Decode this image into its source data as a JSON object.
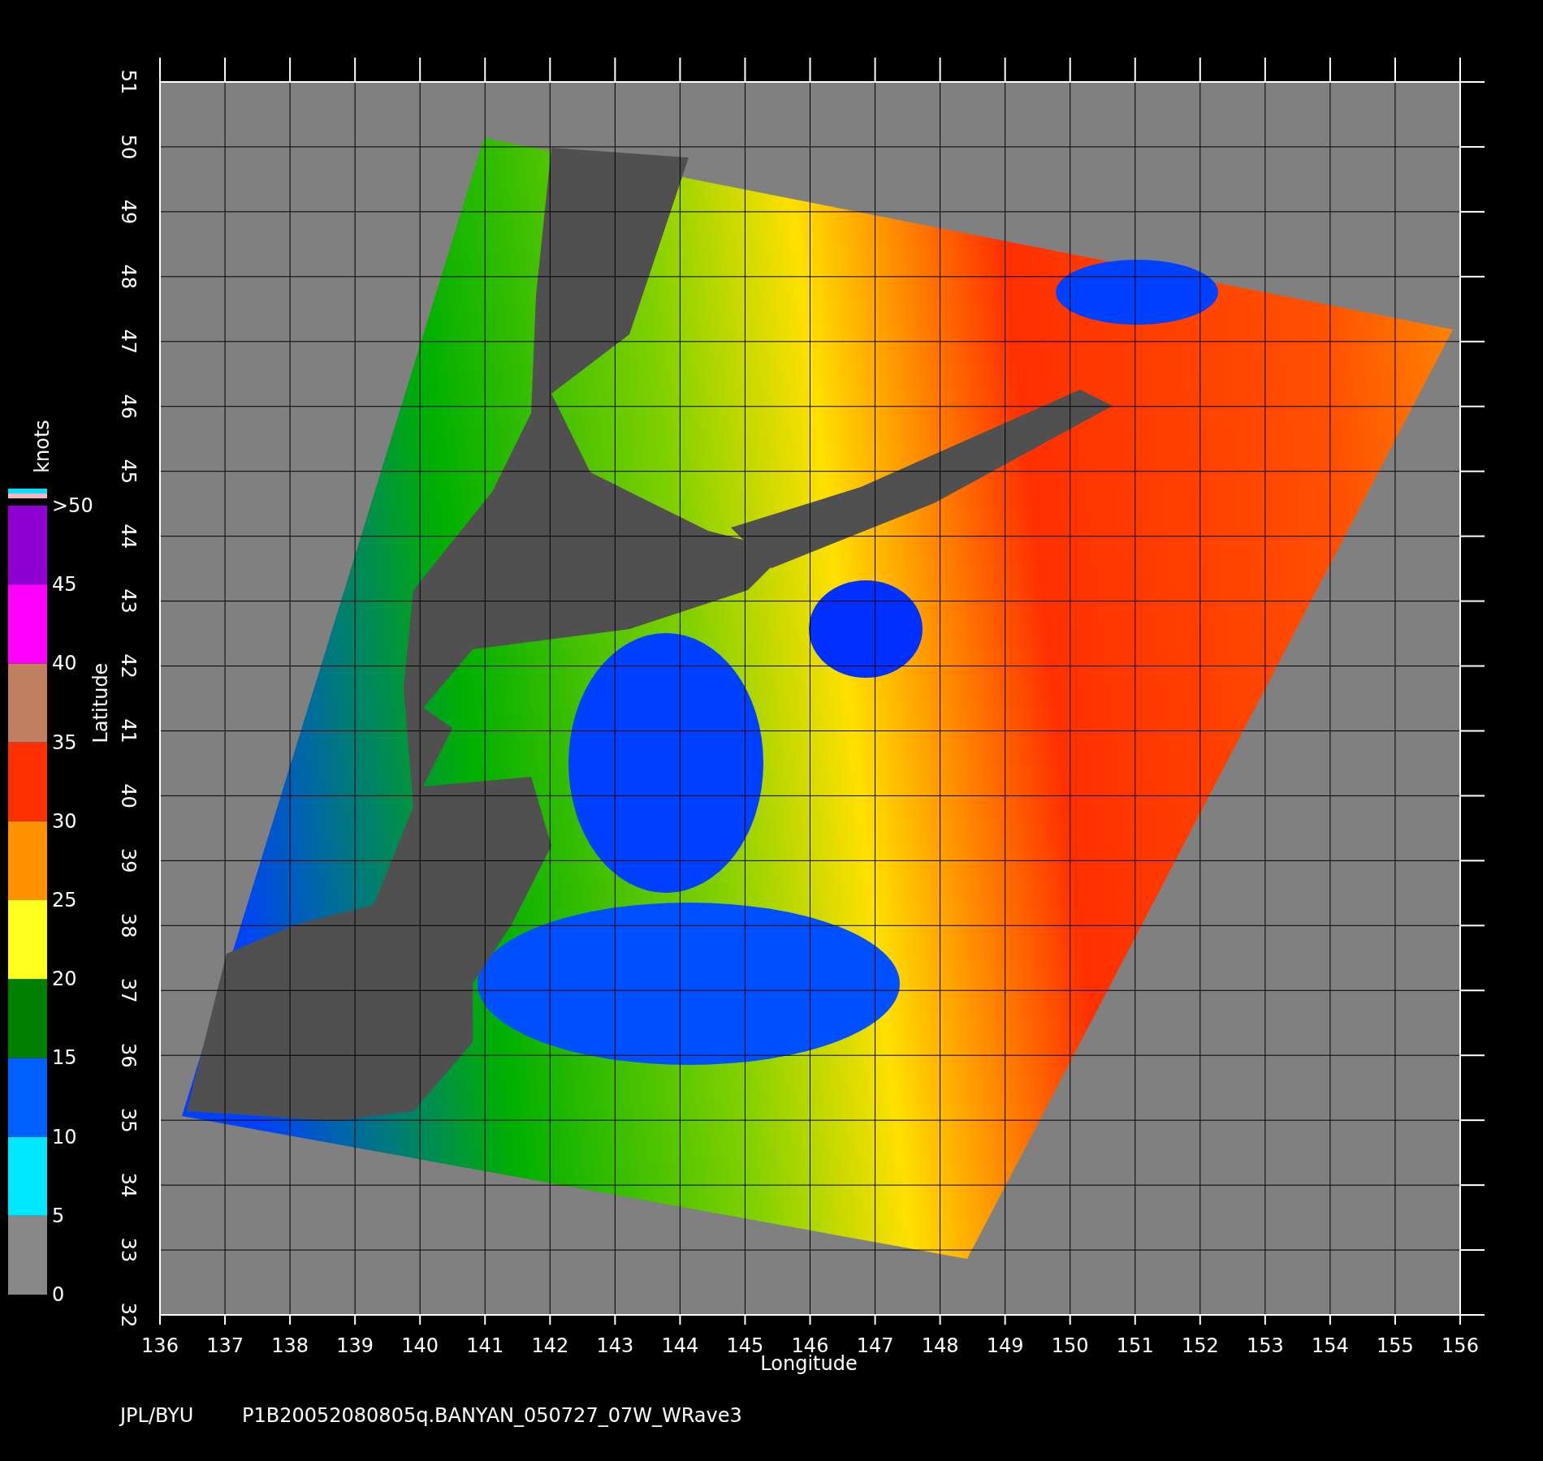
{
  "plot": {
    "xlabel": "Longitude",
    "ylabel": "Latitude",
    "xticks": [
      "136",
      "137",
      "138",
      "139",
      "140",
      "141",
      "142",
      "143",
      "144",
      "145",
      "146",
      "147",
      "148",
      "149",
      "150",
      "151",
      "152",
      "153",
      "154",
      "155",
      "156"
    ],
    "yticks": [
      "32",
      "33",
      "34",
      "35",
      "36",
      "37",
      "38",
      "39",
      "40",
      "41",
      "42",
      "43",
      "44",
      "45",
      "46",
      "47",
      "48",
      "49",
      "50",
      "51"
    ]
  },
  "colorbar": {
    "unit": "knots",
    "labels": [
      ">50",
      "45",
      "40",
      "35",
      "30",
      "25",
      "20",
      "15",
      "10",
      "5",
      "0"
    ]
  },
  "caption": {
    "source": "JPL/BYU",
    "file": "P1B20052080805q.BANYAN_050727_07W_WRave3"
  }
}
